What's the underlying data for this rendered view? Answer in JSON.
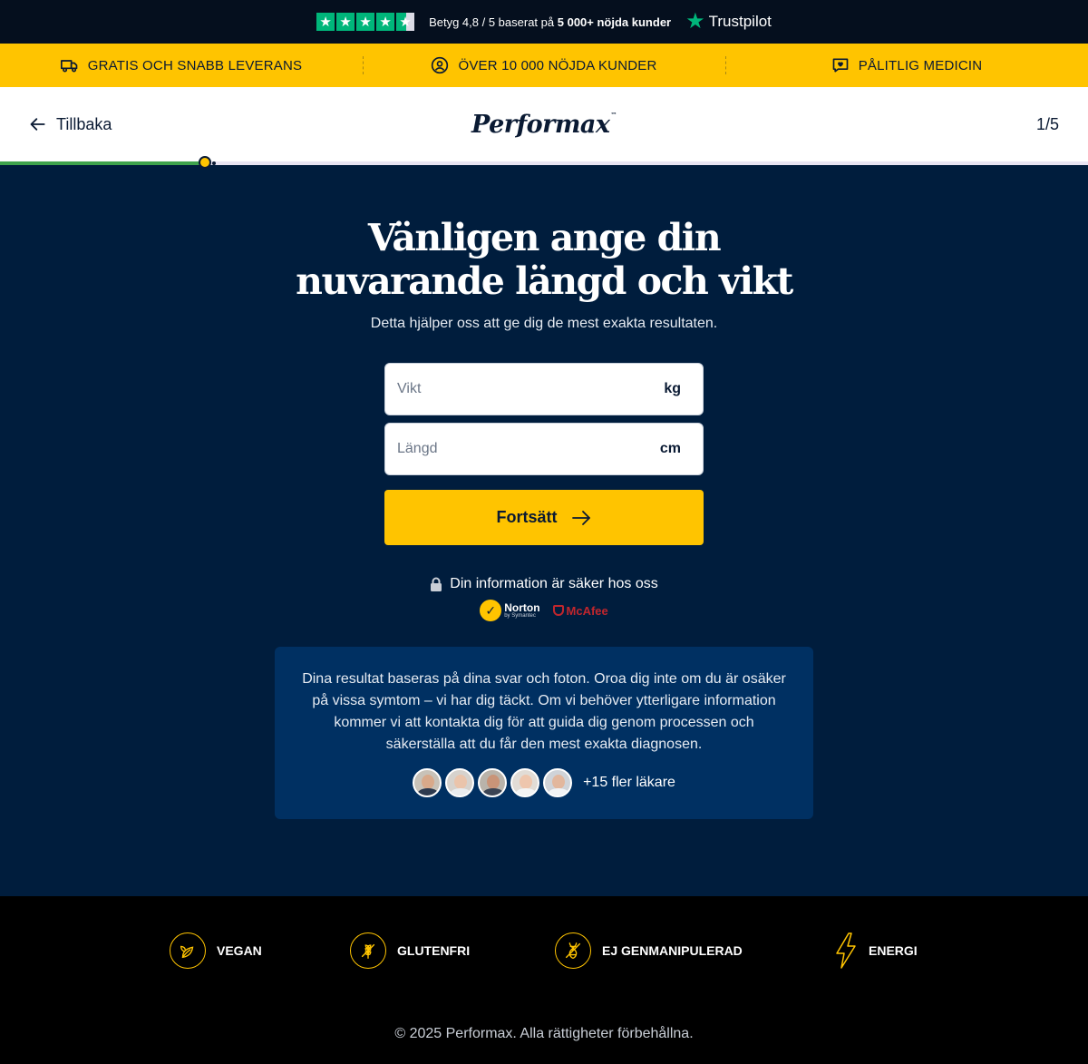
{
  "trustbar": {
    "rating_text": "Betyg 4,8 / 5 baserat på",
    "customers_text": "5 000+ nöjda kunder",
    "brand": "Trustpilot",
    "rating_stars": 4.5
  },
  "usp": {
    "items": [
      {
        "label": "GRATIS OCH SNABB LEVERANS",
        "icon": "truck-icon"
      },
      {
        "label": "ÖVER 10 000 NÖJDA KUNDER",
        "icon": "user-circle-icon"
      },
      {
        "label": "PÅLITLIG MEDICIN",
        "icon": "heart-message-icon"
      }
    ]
  },
  "header": {
    "back_label": "Tillbaka",
    "logo": "Performax",
    "logo_tm": "™",
    "step": "1/5"
  },
  "progress": {
    "fraction": 0.19,
    "colors": {
      "fill": "#3fa34d",
      "marker": "#ffc400"
    }
  },
  "form": {
    "title": "Vänligen ange din nuvarande längd och vikt",
    "subtitle": "Detta hjälper oss att ge dig de mest exakta resultaten.",
    "weight": {
      "placeholder": "Vikt",
      "value": "",
      "unit": "kg"
    },
    "height": {
      "placeholder": "Längd",
      "value": "",
      "unit": "cm"
    },
    "submit_label": "Fortsätt",
    "secure_text": "Din information är säker hos oss",
    "badges": {
      "norton": "Norton",
      "norton_sub": "by Symantec",
      "mcafee": "McAfee"
    }
  },
  "info": {
    "text": "Dina resultat baseras på dina svar och foton. Oroa dig inte om du är osäker på vissa symtom – vi har dig täckt. Om vi behöver ytterligare information kommer vi att kontakta dig för att guida dig genom processen och säkerställa att du får den mest exakta diagnosen.",
    "more_doctors": "+15 fler läkare"
  },
  "footer": {
    "features": [
      {
        "label": "VEGAN",
        "icon": "leaf-icon"
      },
      {
        "label": "GLUTENFRI",
        "icon": "wheat-icon"
      },
      {
        "label": "EJ GENMANIPULERAD",
        "icon": "dna-icon"
      },
      {
        "label": "ENERGI",
        "icon": "lightning-icon"
      }
    ],
    "copyright": "© 2025 Performax. Alla rättigheter förbehållna."
  },
  "colors": {
    "navy": "#001d3d",
    "accent": "#ffc400",
    "info_bg": "#003062",
    "trustpilot": "#00b67a"
  }
}
